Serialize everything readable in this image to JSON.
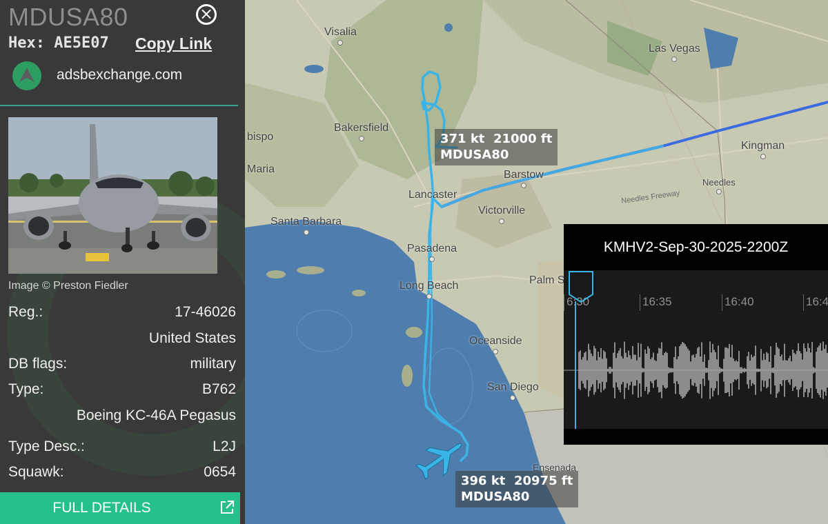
{
  "sidebar": {
    "callsign": "MDUSA80",
    "hex_label": "Hex:",
    "hex_value": "AE5E07",
    "copy_link": "Copy Link",
    "site": "adsbexchange.com",
    "close_icon": "close-icon",
    "photo_credit": "Image © Preston Fiedler",
    "fields": {
      "reg_label": "Reg.:",
      "reg_value": "17-46026",
      "country": "United States",
      "dbflags_label": "DB flags:",
      "dbflags_value": "military",
      "type_label": "Type:",
      "type_value": "B762",
      "type_name": "Boeing KC-46A Pegasus",
      "typedesc_label": "Type Desc.:",
      "typedesc_value": "L2J",
      "squawk_label": "Squawk:",
      "squawk_value": "0654"
    },
    "full_details": "FULL DETAILS",
    "accent": "#26c08d"
  },
  "map": {
    "cities": {
      "visalia": "Visalia",
      "las_vegas": "Las Vegas",
      "bakersfield": "Bakersfield",
      "obispo": "bispo",
      "santa_maria": "Maria",
      "kingman": "Kingman",
      "barstow": "Barstow",
      "needles": "Needles",
      "lancaster": "Lancaster",
      "victorville": "Victorville",
      "santa_barbara": "Santa Barbara",
      "pasadena": "Pasadena",
      "long_beach": "Long Beach",
      "palm_springs": "Palm S",
      "oceanside": "Oceanside",
      "san_diego": "San Diego",
      "ensenada": "Ensenada"
    },
    "road_label": "Needles Freeway",
    "labels": [
      {
        "speed": "371 kt",
        "alt": "21000 ft",
        "callsign": "MDUSA80"
      },
      {
        "speed": "396 kt",
        "alt": "20975 ft",
        "callsign": "MDUSA80"
      }
    ],
    "track_color": "#3ab4e6",
    "aircraft_icon": "airplane-icon"
  },
  "audio": {
    "title": "KMHV2-Sep-30-2025-2200Z",
    "ticks": [
      "6:30",
      "16:35",
      "16:40",
      "16:4"
    ]
  }
}
